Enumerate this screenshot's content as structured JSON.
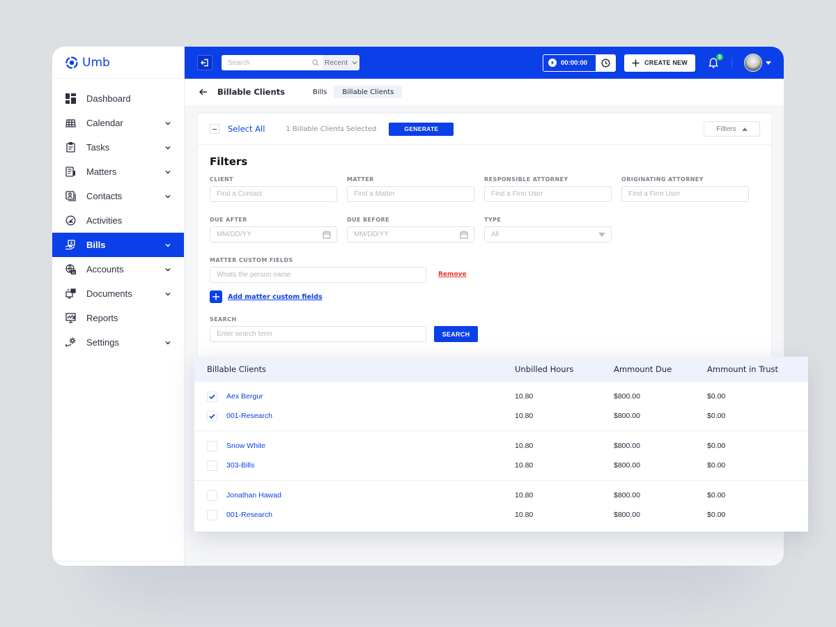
{
  "brand": {
    "name": "Umb"
  },
  "sidebar": {
    "items": [
      {
        "label": "Dashboard",
        "icon": "dashboard-icon",
        "expandable": false,
        "active": false
      },
      {
        "label": "Calendar",
        "icon": "calendar-icon",
        "expandable": true,
        "active": false
      },
      {
        "label": "Tasks",
        "icon": "clipboard-icon",
        "expandable": true,
        "active": false
      },
      {
        "label": "Matters",
        "icon": "matters-icon",
        "expandable": true,
        "active": false
      },
      {
        "label": "Contacts",
        "icon": "contacts-icon",
        "expandable": true,
        "active": false
      },
      {
        "label": "Activities",
        "icon": "gauge-icon",
        "expandable": false,
        "active": false
      },
      {
        "label": "Bills",
        "icon": "bill-hand-icon",
        "expandable": true,
        "active": true
      },
      {
        "label": "Accounts",
        "icon": "globe-bank-icon",
        "expandable": true,
        "active": false
      },
      {
        "label": "Documents",
        "icon": "documents-icon",
        "expandable": true,
        "active": false
      },
      {
        "label": "Reports",
        "icon": "reports-monitor-icon",
        "expandable": false,
        "active": false
      },
      {
        "label": "Settings",
        "icon": "settings-gear-icon",
        "expandable": true,
        "active": false
      }
    ]
  },
  "topbar": {
    "search_placeholder": "Search",
    "recent_label": "Recent",
    "timer_value": "00:00:00",
    "create_new_label": "CREATE NEW",
    "notification_count": "3"
  },
  "subheader": {
    "title": "Billable Clients",
    "breadcrumbs": [
      "Bills",
      "Billable Clients"
    ]
  },
  "toolbar": {
    "select_all_label": "Select All",
    "selected_count_text": "1 Billable Clients Selected",
    "generate_label": "GENERATE",
    "filters_toggle_label": "Filters"
  },
  "filters": {
    "title": "Filters",
    "client": {
      "label": "CLIENT",
      "placeholder": "Find a Contact"
    },
    "matter": {
      "label": "MATTER",
      "placeholder": "Find a Matter"
    },
    "responsible_attorney": {
      "label": "RESPONSIBLE ATTORNEY",
      "placeholder": "Find a Firm User"
    },
    "originating_attorney": {
      "label": "ORIGINATING ATTORNEY",
      "placeholder": "Find a Firm User"
    },
    "due_after": {
      "label": "DUE AFTER",
      "placeholder": "MM/DD/YY"
    },
    "due_before": {
      "label": "DUE BEFORE",
      "placeholder": "MM/DD/YY"
    },
    "type": {
      "label": "TYPE",
      "value": "All"
    },
    "matter_custom_fields": {
      "label": "MATTER CUSTOM FIELDS",
      "placeholder": "Whats the person name",
      "remove_label": "Remove"
    },
    "add_custom_field_label": "Add matter custom fields",
    "search": {
      "label": "SEARCH",
      "placeholder": "Enter search term",
      "button_label": "SEARCH"
    }
  },
  "table": {
    "columns": [
      "Billable Clients",
      "Unbilled Hours",
      "Ammount Due",
      "Ammount in Trust"
    ],
    "groups": [
      {
        "rows": [
          {
            "name": "Aex Bergur",
            "checked": true,
            "hours": "10.80",
            "due": "$800.00",
            "trust": "$0.00"
          },
          {
            "name": "001-Research",
            "checked": true,
            "hours": "10.80",
            "due": "$800.00",
            "trust": "$0.00"
          }
        ]
      },
      {
        "rows": [
          {
            "name": "Snow White",
            "checked": false,
            "hours": "10.80",
            "due": "$800.00",
            "trust": "$0.00"
          },
          {
            "name": "303-Bills",
            "checked": false,
            "hours": "10.80",
            "due": "$800.00",
            "trust": "$0.00"
          }
        ]
      },
      {
        "rows": [
          {
            "name": "Jonathan Hawad",
            "checked": false,
            "hours": "10.80",
            "due": "$800.00",
            "trust": "$0.00"
          },
          {
            "name": "001-Research",
            "checked": false,
            "hours": "10.80",
            "due": "$800.00",
            "trust": "$0.00"
          }
        ]
      }
    ]
  },
  "colors": {
    "accent": "#0b3fe8",
    "danger": "#e23a2a",
    "badge": "#2bc56b"
  }
}
